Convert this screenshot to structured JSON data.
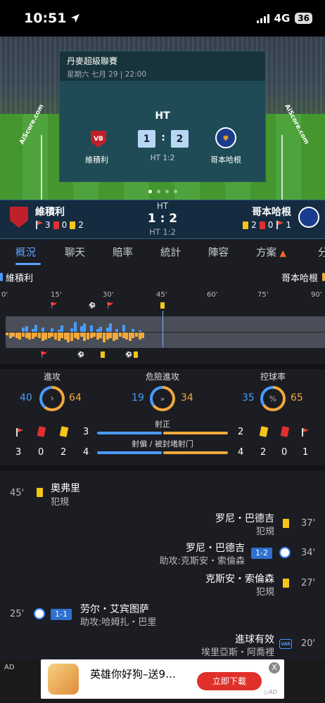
{
  "status_bar": {
    "time": "10:51",
    "network": "4G",
    "battery": "36"
  },
  "match_card": {
    "league": "丹麥超級聯賽",
    "datetime": "星期六 七月 29 | 22:00",
    "status": "HT",
    "home_team": "維積利",
    "away_team": "哥本哈根",
    "home_score": "1",
    "away_score": "2",
    "colon": ":",
    "half_time_score": "HT 1:2",
    "brand_left": "AiScore.com",
    "brand_right": "AiScore.com"
  },
  "score_bar": {
    "home_team": "維積利",
    "away_team": "哥本哈根",
    "status": "HT",
    "score": "1 : 2",
    "half_time": "HT 1:2",
    "home_corners": "3",
    "home_red": "0",
    "home_yellow": "2",
    "away_yellow": "2",
    "away_red": "0",
    "away_corners": "1"
  },
  "tabs": [
    "概況",
    "聊天",
    "賠率",
    "統計",
    "陣容",
    "方案",
    "分"
  ],
  "timeline": {
    "home_label": "維積利",
    "away_label": "哥本哈根",
    "ticks": [
      "0'",
      "15'",
      "30'",
      "45'",
      "60'",
      "75'",
      "90'"
    ]
  },
  "stats": {
    "attack": {
      "label": "進攻",
      "home": "40",
      "away": "64"
    },
    "dangerous": {
      "label": "危險進攻",
      "home": "19",
      "away": "34"
    },
    "possession": {
      "label": "控球率",
      "home": "35",
      "away": "65"
    },
    "shots_on": {
      "label": "射正",
      "home": "3",
      "away": "2"
    },
    "shots_off": {
      "label": "射偏 / 被封堵射门",
      "home": "4",
      "away": "4"
    },
    "home_counts": {
      "corners": "3",
      "red": "0",
      "yellow": "2"
    },
    "away_counts": {
      "yellow": "2",
      "red": "0",
      "corners": "1"
    }
  },
  "events": [
    {
      "minute": "45'",
      "side": "home",
      "name": "奧弗里",
      "detail": "犯規"
    },
    {
      "minute": "37'",
      "side": "away",
      "name": "罗尼・巴德吉",
      "detail": "犯規"
    },
    {
      "minute": "34'",
      "side": "away",
      "name": "罗尼・巴德吉",
      "detail": "助攻:克斯安・索倫森",
      "score": "1-2"
    },
    {
      "minute": "27'",
      "side": "away",
      "name": "克斯安・索倫森",
      "detail": "犯規"
    },
    {
      "minute": "25'",
      "side": "home",
      "name": "劳尔・艾宾图萨",
      "detail": "助攻:哈姆扎・巴里",
      "score": "1-1"
    },
    {
      "minute": "20'",
      "side": "away",
      "name": "進球有效",
      "detail": "埃里亞斯・阿喬裡",
      "var": "VAR"
    }
  ],
  "ad": {
    "tag": "AD",
    "title": "英雄你好狗–送9…",
    "button": "立即下載",
    "close": "X"
  }
}
